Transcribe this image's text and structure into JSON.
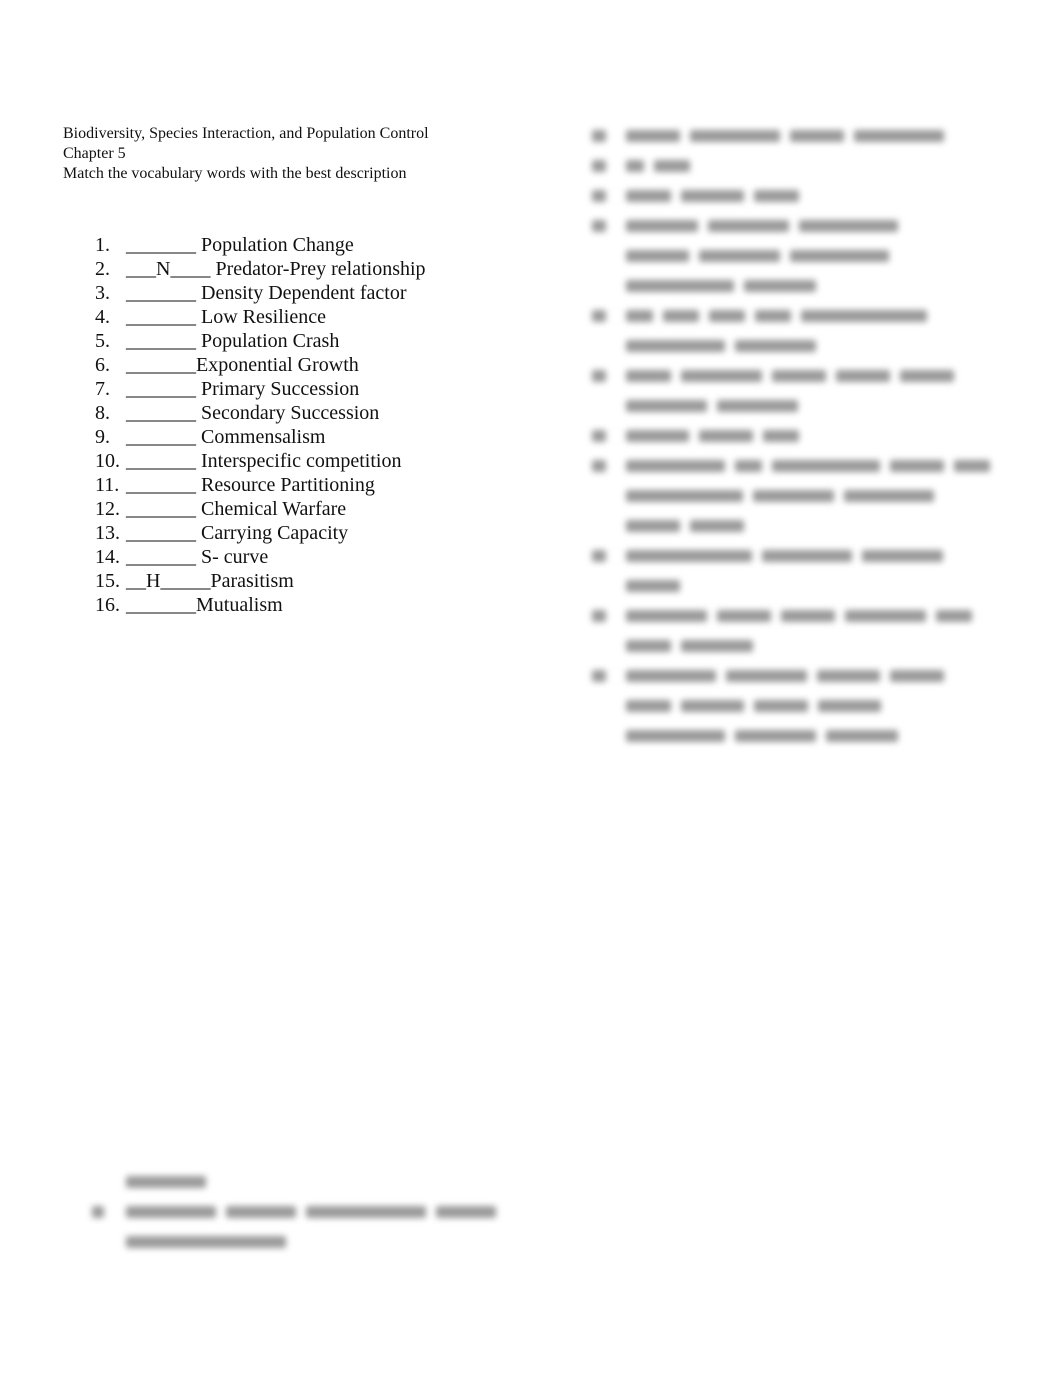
{
  "document": {
    "title": "Biodiversity, Species Interaction, and Population Control",
    "chapter": "Chapter 5",
    "instructions": "Match the vocabulary words with the best description"
  },
  "vocabulary": [
    {
      "number": "1.",
      "answer": "_______ ",
      "term": "Population Change"
    },
    {
      "number": "2.",
      "answer": "___N____ ",
      "term": "Predator-Prey relationship"
    },
    {
      "number": "3.",
      "answer": "_______ ",
      "term": "Density Dependent factor"
    },
    {
      "number": "4.",
      "answer": "_______ ",
      "term": "Low Resilience"
    },
    {
      "number": "5.",
      "answer": "_______ ",
      "term": "Population Crash"
    },
    {
      "number": "6.",
      "answer": "_______",
      "term": "Exponential Growth"
    },
    {
      "number": "7.",
      "answer": "_______ ",
      "term": "Primary Succession"
    },
    {
      "number": "8.",
      "answer": "_______ ",
      "term": "Secondary Succession"
    },
    {
      "number": "9.",
      "answer": "_______ ",
      "term": "Commensalism"
    },
    {
      "number": "10.",
      "answer": "_______ ",
      "term": "Interspecific competition"
    },
    {
      "number": "11.",
      "answer": "_______ ",
      "term": "Resource Partitioning"
    },
    {
      "number": "12.",
      "answer": "_______ ",
      "term": "Chemical Warfare"
    },
    {
      "number": "13.",
      "answer": "_______ ",
      "term": "Carrying Capacity"
    },
    {
      "number": "14.",
      "answer": "_______ ",
      "term": "S- curve"
    },
    {
      "number": "15.",
      "answer": "__H_____",
      "term": "Parasitism"
    },
    {
      "number": "16.",
      "answer": "_______",
      "term": "Mutualism"
    }
  ],
  "blurred_descriptions": {
    "note": "content obscured (blurred preview)"
  }
}
